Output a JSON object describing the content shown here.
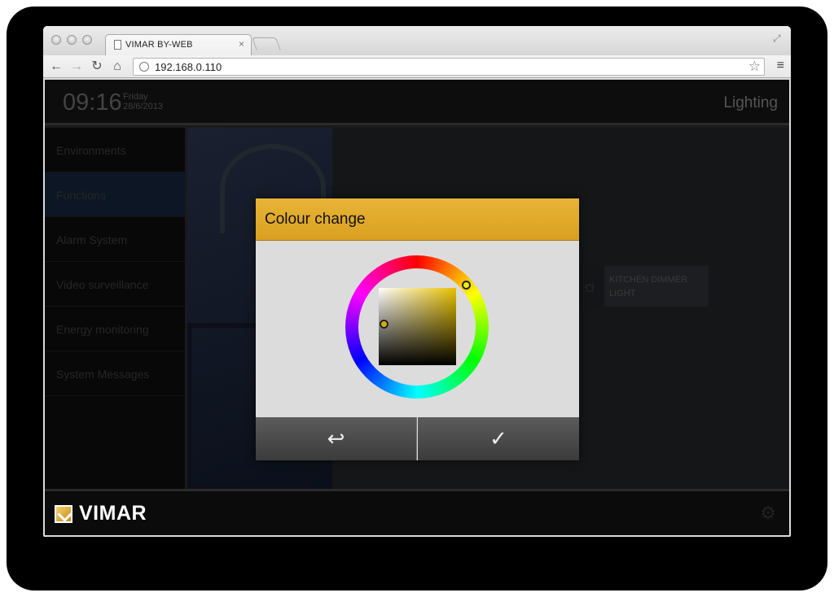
{
  "browser": {
    "tab_title": "VIMAR BY-WEB",
    "tab_close": "×",
    "url": "192.168.0.110",
    "back": "←",
    "forward": "→",
    "reload": "↻",
    "home": "⌂",
    "star": "☆",
    "menu": "≡"
  },
  "header": {
    "time": "09:16",
    "day": "Friday",
    "date": "28/6/2013",
    "section": "Lighting"
  },
  "sidebar": {
    "items": [
      {
        "label": "Environments"
      },
      {
        "label": "Functions"
      },
      {
        "label": "Alarm System"
      },
      {
        "label": "Video surveillance"
      },
      {
        "label": "Energy monitoring"
      },
      {
        "label": "System Messages"
      }
    ]
  },
  "kitchen": {
    "label": "KITCHEN DIMMER LIGHT"
  },
  "footer": {
    "logo": "VIMAR"
  },
  "dialog": {
    "title": "Colour change",
    "back_icon": "back-icon",
    "ok_icon": "check-icon",
    "back_glyph": "↩",
    "ok_glyph": "✓"
  },
  "colors": {
    "accent": "#e0a82c",
    "selected_hue": "#f2f000"
  }
}
